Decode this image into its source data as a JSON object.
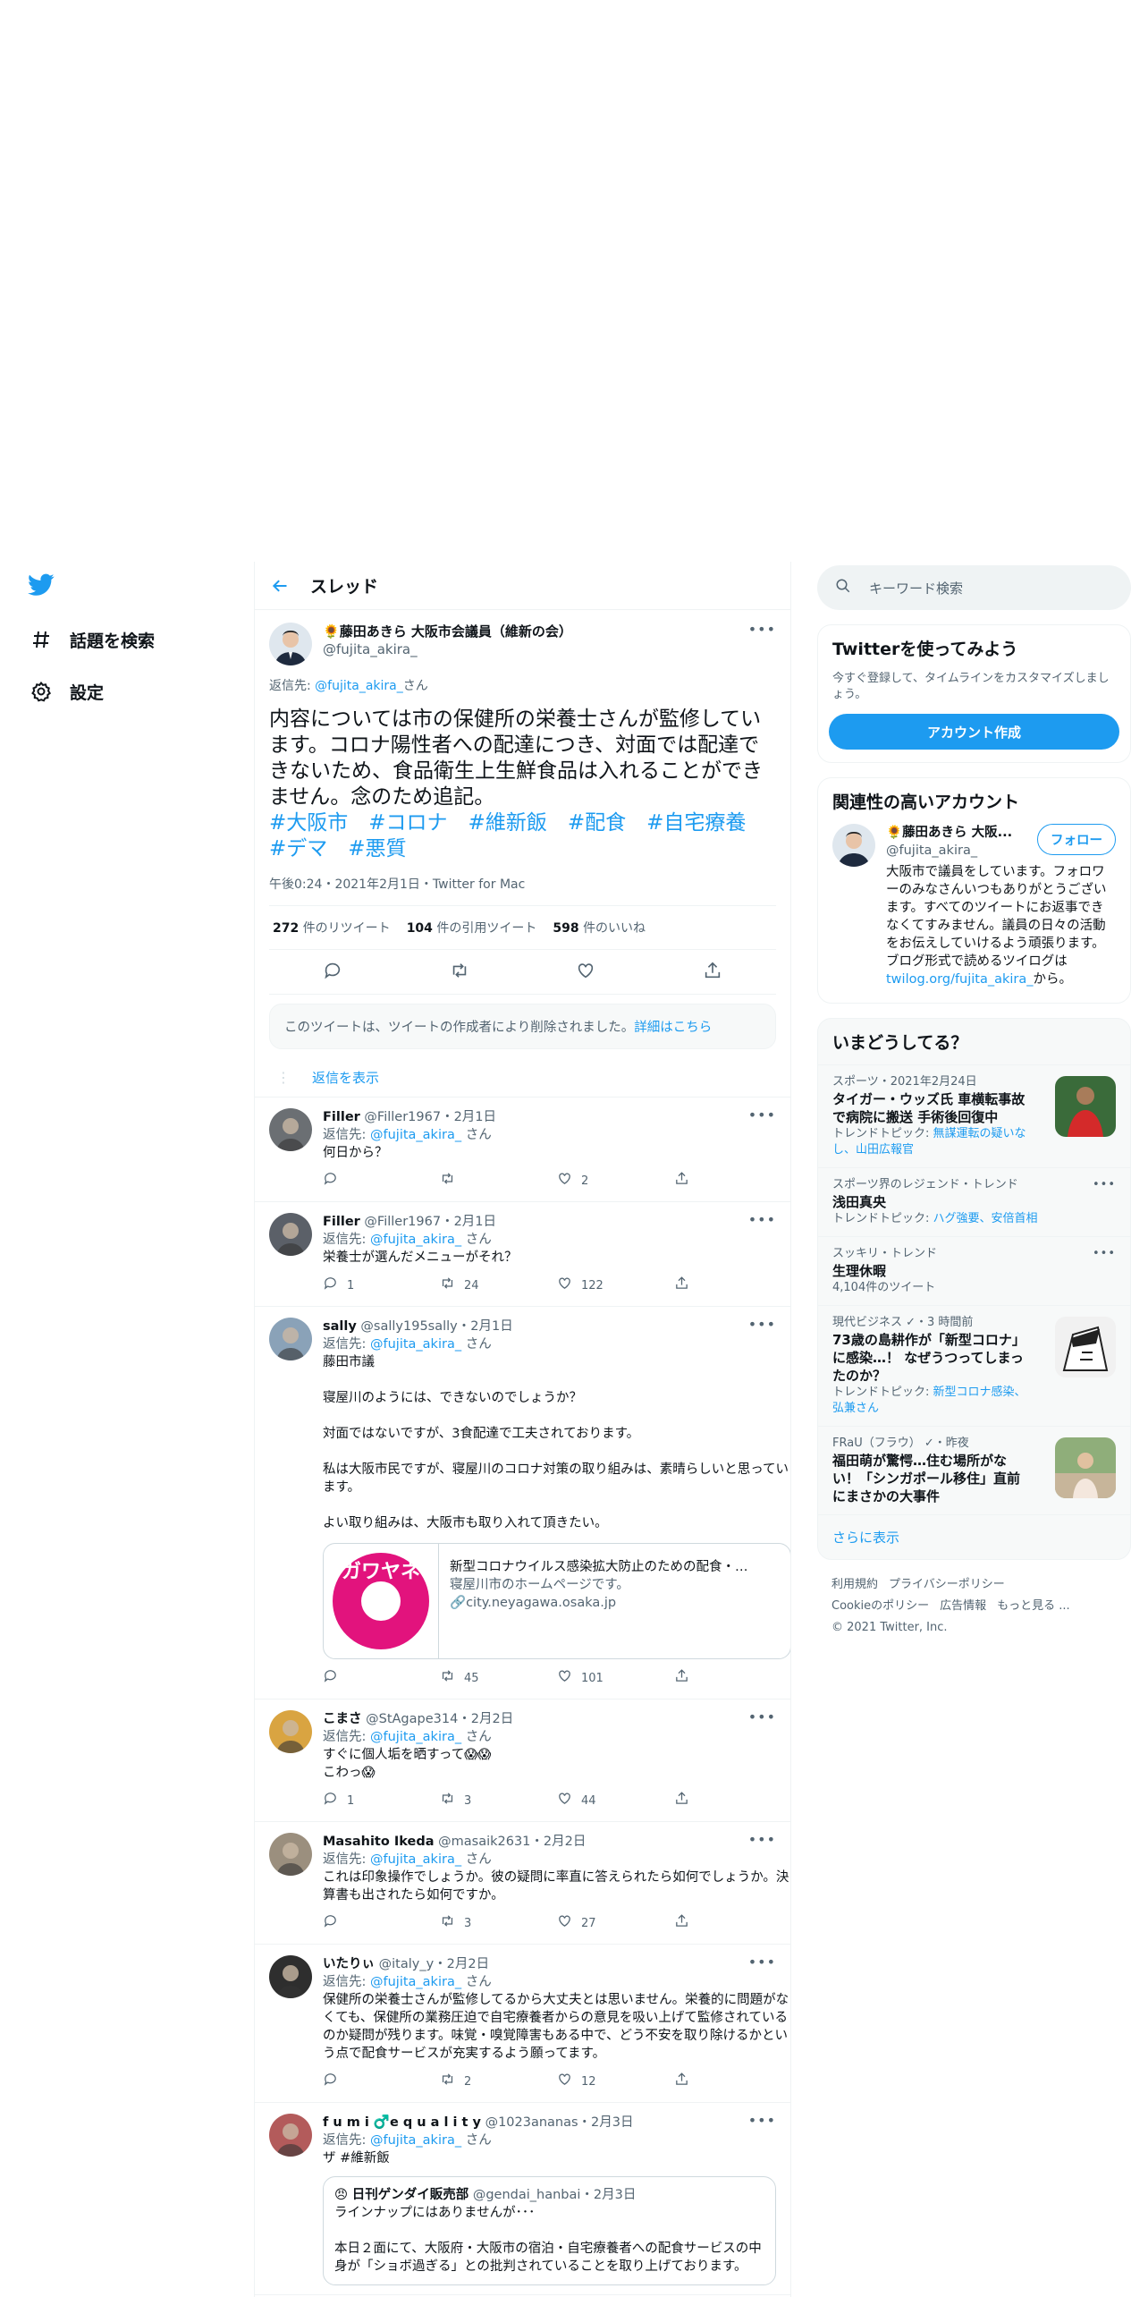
{
  "nav": {
    "explore": "話題を検索",
    "settings": "設定"
  },
  "header": {
    "title": "スレッド"
  },
  "main_tweet": {
    "name": "藤田あきら 大阪市会議員（維新の会）",
    "handle": "@fujita_akira_",
    "reply_prefix": "返信先: ",
    "reply_handle": "@fujita_akira_",
    "reply_suffix": "さん",
    "text": "内容については市の保健所の栄養士さんが監修しています。コロナ陽性者への配達につき、対面では配達できないため、食品衛生上生鮮食品は入れることができません。念のため追記。",
    "tags": "#大阪市　#コロナ　#維新飯　#配食　#自宅療養　#デマ　#悪質",
    "time": "午後0:24・2021年2月1日・Twitter for Mac",
    "retweets": "272",
    "retweets_label": "件のリツイート",
    "quotes": "104",
    "quotes_label": "件の引用ツイート",
    "likes": "598",
    "likes_label": "件のいいね"
  },
  "deleted_notice": {
    "text": "このツイートは、ツイートの作成者により削除されました。",
    "link": "詳細はこちら"
  },
  "show_replies": "返信を表示",
  "replies": [
    {
      "name": "Filler",
      "handle": "@Filler1967・2月1日",
      "reply_to": "@fujita_akira_",
      "text": "何日から？",
      "reply_count": "",
      "retweet_count": "",
      "like_count": "2"
    },
    {
      "name": "Filler",
      "handle": "@Filler1967・2月1日",
      "reply_to": "@fujita_akira_",
      "text": "栄養士が選んだメニューがそれ？",
      "reply_count": "1",
      "retweet_count": "24",
      "like_count": "122"
    },
    {
      "name": "sally",
      "handle": "@sally195sally・2月1日",
      "reply_to": "@fujita_akira_",
      "text": "藤田市議\n\n寝屋川のようには、できないのでしょうか？\n\n対面ではないですが、3食配達で工夫されております。\n\n私は大阪市民ですが、寝屋川のコロナ対策の取り組みは、素晴らしいと思っています。\n\nよい取り組みは、大阪市も取り入れて頂きたい。",
      "reply_count": "",
      "retweet_count": "45",
      "like_count": "101",
      "card": {
        "title": "新型コロナウイルス感染拡大防止のための配食・…",
        "desc": "寝屋川市のホームページです。",
        "domain": "city.neyagawa.osaka.jp",
        "logo_text": "ガワヤネ"
      }
    },
    {
      "name": "こまさ",
      "handle": "@StAgape314・2月2日",
      "reply_to": "@fujita_akira_",
      "text": "すぐに個人垢を晒すって😱😱\nこわっ😱",
      "reply_count": "1",
      "retweet_count": "3",
      "like_count": "44"
    },
    {
      "name": "Masahito Ikeda",
      "handle": "@masaik2631・2月2日",
      "reply_to": "@fujita_akira_",
      "text": "これは印象操作でしょうか。彼の疑問に率直に答えられたら如何でしょうか。決算書も出されたら如何ですか。",
      "reply_count": "",
      "retweet_count": "3",
      "like_count": "27"
    },
    {
      "name": "いたりぃ",
      "handle": "@italy_y・2月2日",
      "reply_to": "@fujita_akira_",
      "text": "保健所の栄養士さんが監修してるから大丈夫とは思いません。栄養的に問題がなくても、保健所の業務圧迫で自宅療養者からの意見を吸い上げて監修されているのか疑問が残ります。味覚・嗅覚障害もある中で、どう不安を取り除けるかという点で配食サービスが充実するよう願ってます。",
      "reply_count": "",
      "retweet_count": "2",
      "like_count": "12"
    },
    {
      "name": "f u m i ♂️e q u a l i t y",
      "handle": "@1023ananas・2月3日",
      "reply_to": "@fujita_akira_",
      "text": "ザ #維新飯",
      "reply_count": "",
      "retweet_count": "",
      "like_count": "",
      "quote": {
        "name": "日刊ゲンダイ販売部",
        "handle": "@gendai_hanbai・2月3日",
        "text": "ラインナップにはありませんが･･･\n\n本日２面にて、大阪府・大阪市の宿泊・自宅療養者への配食サービスの中身が「ショボ過ぎる」との批判されていることを取り上げております。"
      }
    }
  ],
  "search": {
    "placeholder": "キーワード検索"
  },
  "signup": {
    "title": "Twitterを使ってみよう",
    "desc": "今すぐ登録して、タイムラインをカスタマイズしましょう。",
    "button": "アカウント作成"
  },
  "related": {
    "title": "関連性の高いアカウント",
    "name": "藤田あきら 大阪...",
    "handle": "@fujita_akira_",
    "follow": "フォロー",
    "bio": "大阪市で議員をしています。フォロワーのみなさんいつもありがとうございます。すべてのツイートにお返事できなくてすみません。議員の日々の活動をお伝えしていけるよう頑張ります。ブログ形式で読めるツイログは",
    "bio_link": "twilog.org/fujita_akira_",
    "bio_end": "から。"
  },
  "trends": {
    "title": "いまどうしてる？",
    "items": [
      {
        "meta": "スポーツ・2021年2月24日",
        "title": "タイガー・ウッズ氏 車横転事故で病院に搬送 手術後回復中",
        "sub_label": "トレンドトピック: ",
        "sub_link": "無謀運転の疑いなし、山田広報官",
        "thumb": "golfer"
      },
      {
        "meta": "スポーツ界のレジェンド・トレンド",
        "title": "浅田真央",
        "sub_label": "トレンドトピック: ",
        "sub_link": "ハグ強要、安倍首相",
        "thumb": ""
      },
      {
        "meta": "スッキリ・トレンド",
        "title": "生理休暇",
        "sub_label": "4,104件のツイート",
        "sub_link": "",
        "thumb": ""
      },
      {
        "meta": "現代ビジネス ✓・3 時間前",
        "title": "73歳の島耕作が「新型コロナ」に感染…！ なぜうつってしまったのか？",
        "sub_label": "トレンドトピック: ",
        "sub_link": "新型コロナ感染、弘兼さん",
        "thumb": "manga"
      },
      {
        "meta": "FRaU（フラウ） ✓・昨夜",
        "title": "福田萌が驚愕…住む場所がない！「シンガポール移住」直前にまさかの大事件",
        "sub_label": "",
        "sub_link": "",
        "thumb": "photo"
      }
    ],
    "more": "さらに表示"
  },
  "footer": {
    "terms": "利用規約",
    "privacy": "プライバシーポリシー",
    "cookie": "Cookieのポリシー",
    "ads": "広告情報",
    "more": "もっと見る ...",
    "copyright": "© 2021 Twitter, Inc."
  },
  "colors": {
    "accent": "#1d9bf0",
    "text": "#0f1419",
    "muted": "#536471"
  }
}
